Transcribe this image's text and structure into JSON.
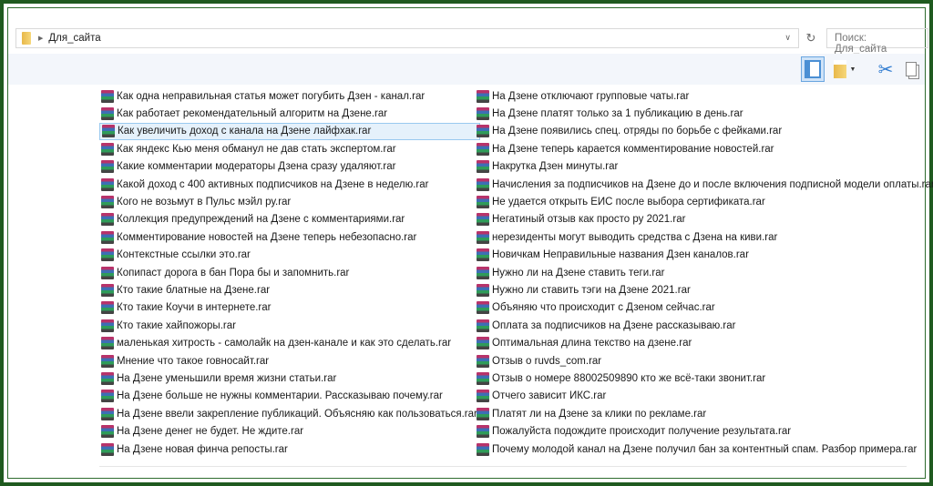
{
  "address": {
    "path": "Для_сайта",
    "search_placeholder": "Поиск: Для_сайта"
  },
  "icons": {
    "folder": "folder-icon",
    "pane": "preview-pane-icon",
    "properties": "properties-icon",
    "cut": "scissors-icon",
    "copy": "copy-icon",
    "file": "winrar-archive-icon"
  },
  "files_left": [
    "Как одна неправильная статья может погубить Дзен - канал.rar",
    "Как работает рекомендательный алгоритм на Дзене.rar",
    "Как увеличить доход  с канала на Дзене лайфхак.rar",
    "Как яндекс Кью меня обманул не дав стать экспертом.rar",
    "Какие комментарии модераторы Дзена сразу удаляют.rar",
    "Какой доход с 400 активных подписчиков на Дзене в неделю.rar",
    "Кого не возьмут в Пульс мэйл ру.rar",
    "Коллекция предупреждений на Дзене с комментариями.rar",
    "Комментирование новостей на Дзене теперь небезопасно.rar",
    "Контекстные ссылки это.rar",
    "Копипаст  дорога в бан Пора бы и запомнить.rar",
    "Кто такие блатные на Дзене.rar",
    "Кто такие Коучи в интернете.rar",
    "Кто такие хайпожоры.rar",
    "маленькая хитрость - самолайк на дзен-канале и как это сделать.rar",
    "Мнение что такое говносайт.rar",
    "На Дзене  уменьшили время жизни статьи.rar",
    "На Дзене больше не нужны комментарии. Рассказываю почему.rar",
    "На Дзене ввели закрепление публикаций. Объясняю как пользоваться.rar",
    "На Дзене денег не будет. Не ждите.rar",
    "На Дзене новая финча репосты.rar"
  ],
  "files_right": [
    "На Дзене отключают групповые чаты.rar",
    "На Дзене платят только за 1 публикацию в день.rar",
    "На Дзене появились спец. отряды по борьбе с фейками.rar",
    "На Дзене теперь карается комментирование новостей.rar",
    "Накрутка Дзен минуты.rar",
    "Начисления за подписчиков на Дзене до и после включения подписной модели оплаты.rar",
    "Не удается открыть ЕИС после выбора сертификата.rar",
    "Негатиный отзыв как просто ру 2021.rar",
    "нерезиденты могут выводить средства с Дзена на киви.rar",
    "Новичкам Неправильные названия Дзен каналов.rar",
    "Нужно ли на Дзене ставить теги.rar",
    "Нужно ли ставить тэги на Дзене 2021.rar",
    "Объяняю что происходит с Дзеном сейчас.rar",
    "Оплата за подписчиков на Дзене рассказываю.rar",
    "Оптимальная длина текство на дзене.rar",
    "Отзыв о ruvds_com.rar",
    "Отзыв о номере 88002509890 кто же всё-таки звонит.rar",
    "Отчего зависит ИКС.rar",
    "Платят ли на Дзене за клики по рекламе.rar",
    "Пожалуйста подождите происходит получение результата.rar",
    "Почему молодой канал на Дзене получил бан за контентный спам. Разбор примера.rar"
  ],
  "selected_left_index": 2
}
